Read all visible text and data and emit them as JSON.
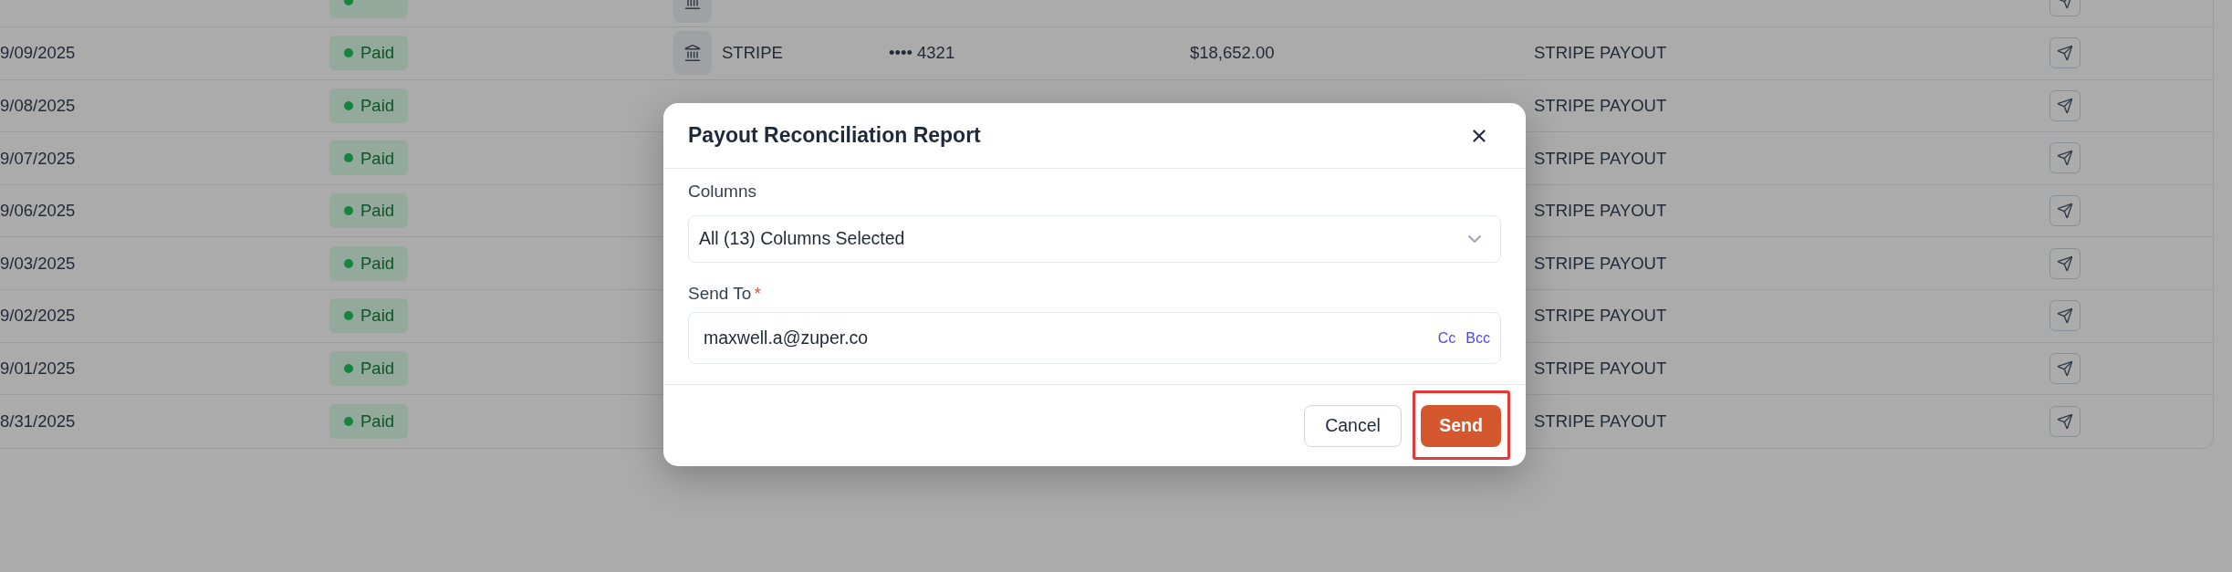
{
  "table": {
    "rows": [
      {
        "bank_icon": true
      },
      {
        "date": "9/09/2025",
        "status": "Paid",
        "bank_icon": true,
        "bank": "STRIPE",
        "account": "•••• 4321",
        "amount": "$18,652.00",
        "description": "STRIPE PAYOUT"
      },
      {
        "date": "9/08/2025",
        "status": "Paid",
        "bank_icon": false,
        "description": "STRIPE PAYOUT"
      },
      {
        "date": "9/07/2025",
        "status": "Paid",
        "bank_icon": false,
        "description": "STRIPE PAYOUT"
      },
      {
        "date": "9/06/2025",
        "status": "Paid",
        "bank_icon": false,
        "description": "STRIPE PAYOUT"
      },
      {
        "date": "9/03/2025",
        "status": "Paid",
        "bank_icon": false,
        "description": "STRIPE PAYOUT"
      },
      {
        "date": "9/02/2025",
        "status": "Paid",
        "bank_icon": false,
        "description": "STRIPE PAYOUT"
      },
      {
        "date": "9/01/2025",
        "status": "Paid",
        "bank_icon": false,
        "description": "STRIPE PAYOUT"
      },
      {
        "date": "8/31/2025",
        "status": "Paid",
        "bank_icon": false,
        "description": "STRIPE PAYOUT"
      }
    ]
  },
  "dialog": {
    "title": "Payout Reconciliation Report",
    "fields": [
      {
        "kind": "select",
        "label": "Columns",
        "value": "All (13) Columns Selected"
      },
      {
        "kind": "email",
        "label": "Send To",
        "required_mark": "*",
        "value": "maxwell.a@zuper.co",
        "links": [
          "Cc",
          "Bcc"
        ]
      }
    ],
    "buttons": [
      {
        "label": "Cancel",
        "kind": "secondary",
        "highlighted": false
      },
      {
        "label": "Send",
        "kind": "primary",
        "highlighted": true
      }
    ]
  }
}
